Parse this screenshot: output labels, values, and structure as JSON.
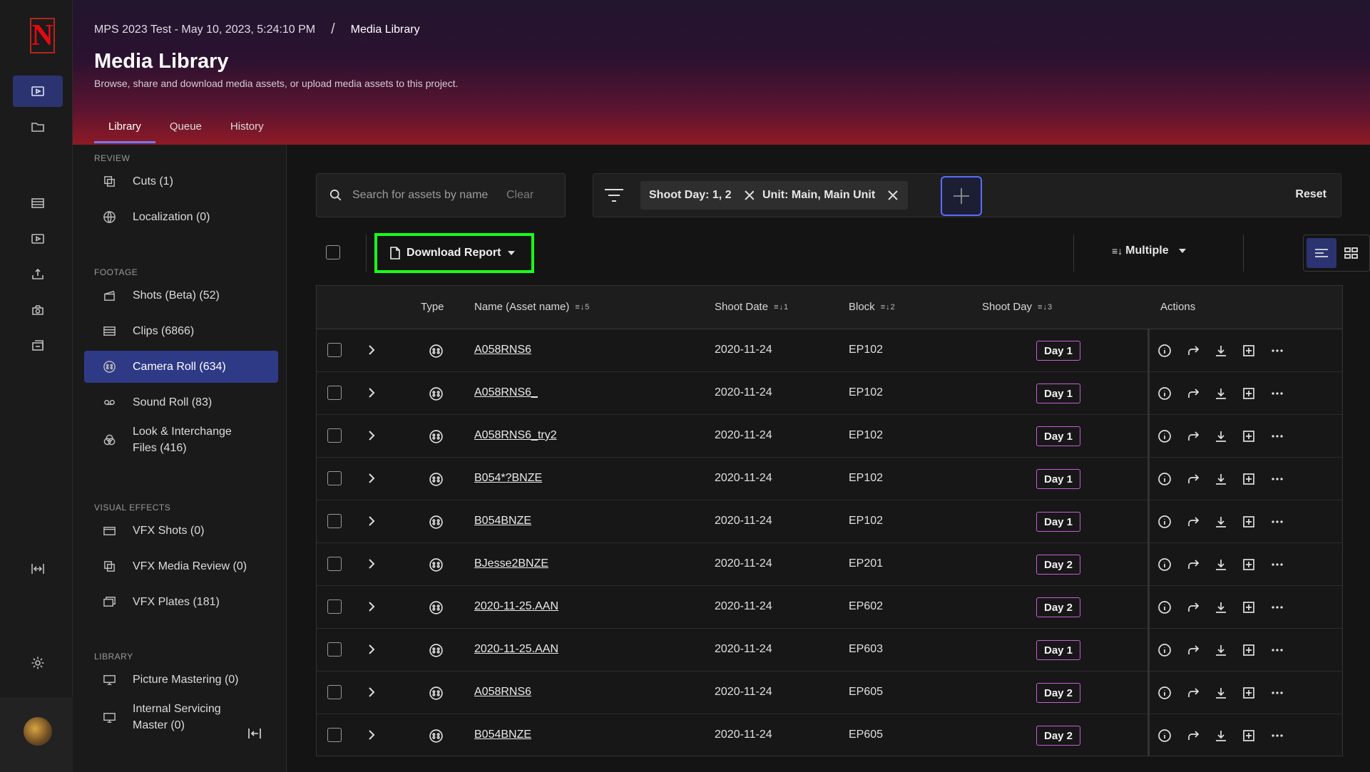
{
  "app": {
    "logo_letter": "N",
    "brand_color": "#e50914",
    "accent": "#2f3a86"
  },
  "breadcrumb": {
    "project": "MPS 2023 Test - May 10, 2023, 5:24:10 PM",
    "separator": "/",
    "current": "Media Library"
  },
  "page": {
    "title": "Media Library",
    "subtitle": "Browse, share and download media assets, or upload media assets to this project."
  },
  "tabs": [
    {
      "label": "Library"
    },
    {
      "label": "Queue"
    },
    {
      "label": "History"
    }
  ],
  "sidebar": {
    "sections": [
      {
        "label": "REVIEW"
      },
      {
        "label": "FOOTAGE"
      },
      {
        "label": "VISUAL EFFECTS"
      },
      {
        "label": "LIBRARY"
      }
    ],
    "items": [
      {
        "label": "Cuts (1)",
        "icon": "cuts-icon"
      },
      {
        "label": "Localization (0)",
        "icon": "globe-icon"
      },
      {
        "label": "Shots (Beta) (52)",
        "icon": "clapper-icon"
      },
      {
        "label": "Clips (6866)",
        "icon": "film-icon"
      },
      {
        "label": "Camera Roll (634)",
        "icon": "camera-roll-icon"
      },
      {
        "label": "Sound Roll (83)",
        "icon": "tape-icon"
      },
      {
        "label": "Look & Interchange Files (416)",
        "icon": "color-circles-icon"
      },
      {
        "label": "VFX Shots (0)",
        "icon": "vfx-shots-icon"
      },
      {
        "label": "VFX Media Review (0)",
        "icon": "vfx-review-icon"
      },
      {
        "label": "VFX Plates (181)",
        "icon": "plates-icon"
      },
      {
        "label": "Picture Mastering (0)",
        "icon": "monitor-icon"
      },
      {
        "label": "Internal Servicing Master (0)",
        "icon": "monitor-icon"
      }
    ]
  },
  "search": {
    "placeholder": "Search for assets by name",
    "clear_label": "Clear"
  },
  "filters": {
    "chips": [
      {
        "label": "Shoot Day: 1, 2"
      },
      {
        "label": "Unit: Main, Main Unit"
      }
    ],
    "reset_label": "Reset"
  },
  "toolbar": {
    "download_report_label": "Download Report",
    "sort_label": "Multiple"
  },
  "table": {
    "columns": {
      "type": "Type",
      "name": "Name (Asset name)",
      "name_sort": "5",
      "shoot_date": "Shoot Date",
      "shoot_date_sort": "1",
      "block": "Block",
      "block_sort": "2",
      "shoot_day": "Shoot Day",
      "shoot_day_sort": "3",
      "actions": "Actions"
    },
    "rows": [
      {
        "name": "A058RNS6",
        "date": "2020-11-24",
        "block": "EP102",
        "day": "Day 1"
      },
      {
        "name": "A058RNS6_",
        "date": "2020-11-24",
        "block": "EP102",
        "day": "Day 1"
      },
      {
        "name": "A058RNS6_try2",
        "date": "2020-11-24",
        "block": "EP102",
        "day": "Day 1"
      },
      {
        "name": "B054*?BNZE",
        "date": "2020-11-24",
        "block": "EP102",
        "day": "Day 1"
      },
      {
        "name": "B054BNZE",
        "date": "2020-11-24",
        "block": "EP102",
        "day": "Day 1"
      },
      {
        "name": "BJesse2BNZE",
        "date": "2020-11-24",
        "block": "EP201",
        "day": "Day 2"
      },
      {
        "name": "2020-11-25.AAN",
        "date": "2020-11-24",
        "block": "EP602",
        "day": "Day 2"
      },
      {
        "name": "2020-11-25.AAN",
        "date": "2020-11-24",
        "block": "EP603",
        "day": "Day 1"
      },
      {
        "name": "A058RNS6",
        "date": "2020-11-24",
        "block": "EP605",
        "day": "Day 2"
      },
      {
        "name": "B054BNZE",
        "date": "2020-11-24",
        "block": "EP605",
        "day": "Day 2"
      }
    ]
  }
}
